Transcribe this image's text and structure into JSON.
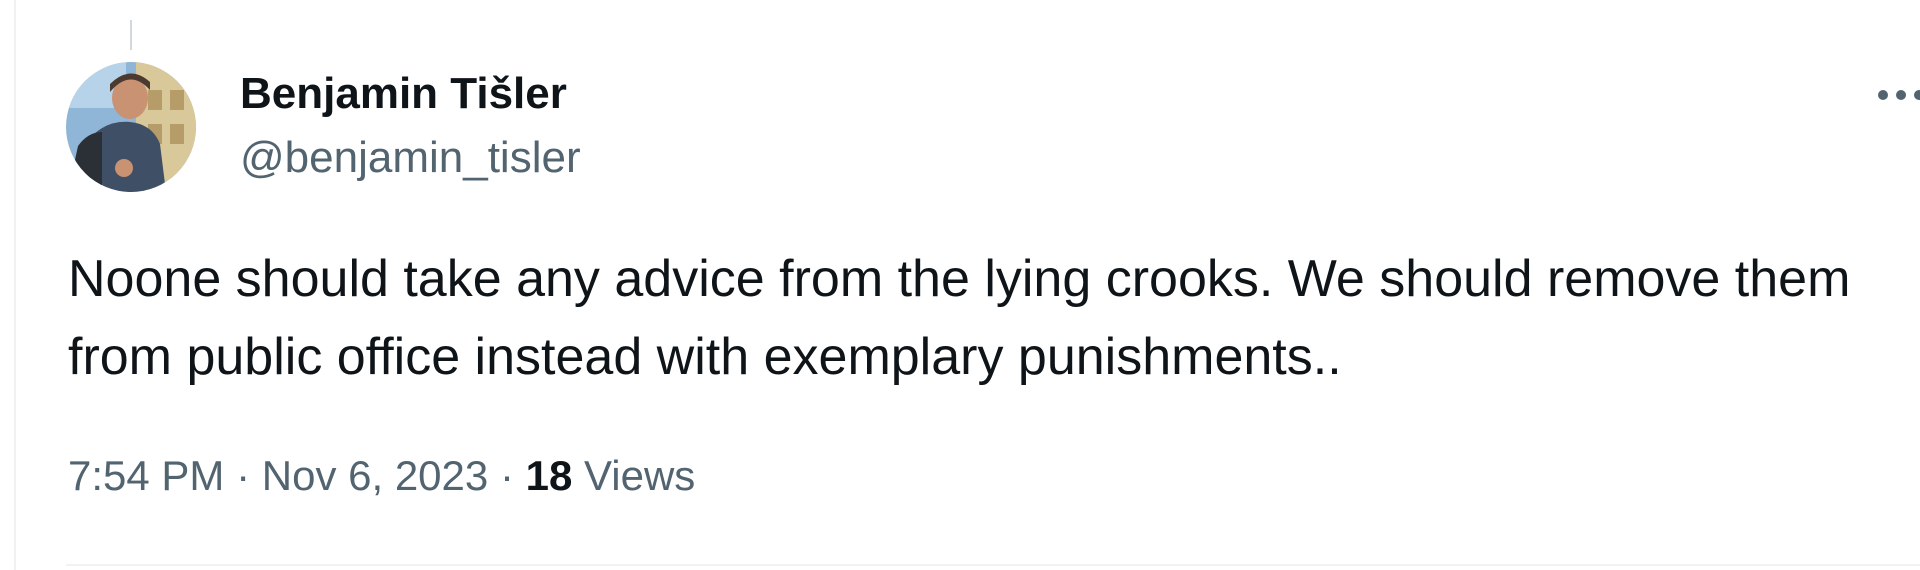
{
  "author": {
    "display_name": "Benjamin Tišler",
    "handle": "@benjamin_tisler"
  },
  "tweet": {
    "text": "Noone should take any advice from the lying crooks. We should remove them from public office instead with exemplary punishments..",
    "time": "7:54 PM",
    "separator": "·",
    "date": "Nov 6, 2023",
    "views_count": "18",
    "views_label": "Views"
  },
  "icons": {
    "more": "more-horizontal-icon"
  },
  "colors": {
    "text_primary": "#0f1419",
    "text_secondary": "#536471",
    "divider": "#eff3f4"
  }
}
